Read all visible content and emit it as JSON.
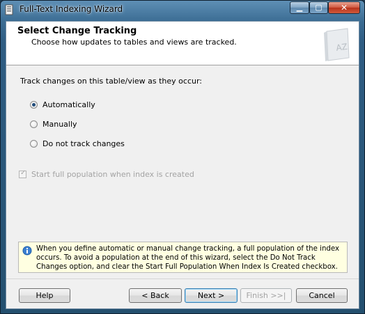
{
  "window": {
    "title": "Full-Text Indexing Wizard",
    "caption_buttons": {
      "minimize": "▁",
      "maximize": "▢",
      "close": "✕"
    }
  },
  "header": {
    "title": "Select Change Tracking",
    "subtitle": "Choose how updates to tables and views are tracked.",
    "icon": "book-az-icon"
  },
  "content": {
    "prompt": "Track changes on this table/view as they occur:",
    "options": [
      {
        "label": "Automatically",
        "checked": true
      },
      {
        "label": "Manually",
        "checked": false
      },
      {
        "label": "Do not track changes",
        "checked": false
      }
    ],
    "start_population": {
      "label": "Start full population when index is created",
      "checked": true,
      "enabled": false
    },
    "info": {
      "icon": "info-icon",
      "text": "When you define automatic or manual change tracking, a full population of the index occurs. To avoid a population at the end of this wizard, select the Do Not Track Changes option, and clear the Start Full Population When Index Is Created checkbox."
    }
  },
  "footer": {
    "help": "Help",
    "back": "< Back",
    "next": "Next >",
    "finish": "Finish >>|",
    "cancel": "Cancel"
  },
  "colors": {
    "accent": "#214c7a",
    "info_bg": "#ffffe1",
    "title_bar": "#3b6c93"
  }
}
